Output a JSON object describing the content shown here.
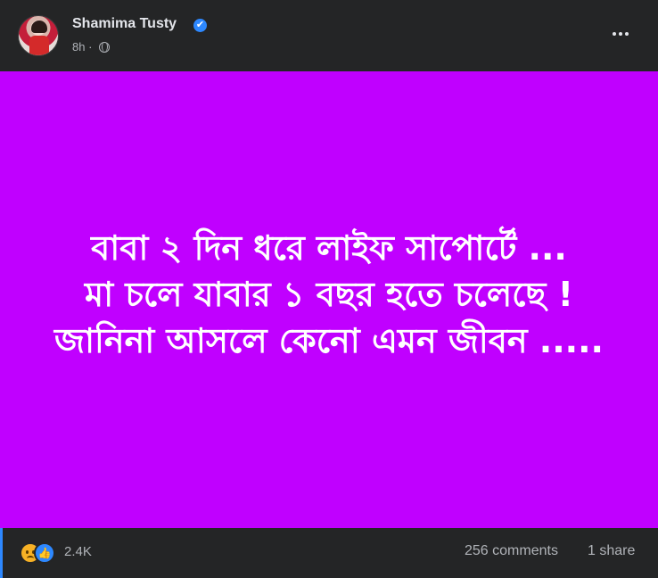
{
  "header": {
    "author_name": "Shamima Tusty",
    "verified_mark": "✔",
    "timestamp": "8h ·",
    "privacy_icon": "globe-icon",
    "more_icon": "more-options-icon"
  },
  "post": {
    "background_color": "#c000ff",
    "lines": [
      "বাবা ২ দিন ধরে লাইফ সাপোর্টে ...",
      "মা চলে যাবার ১ বছর হতে চলেছে !",
      "জানিনা আসলে কেনো এমন জীবন ....."
    ]
  },
  "footer": {
    "reaction_icons": [
      "sad-icon",
      "like-icon"
    ],
    "like_glyph": "👍",
    "reaction_count": "2.4K",
    "comments": "256 comments",
    "shares": "1 share"
  },
  "colors": {
    "background": "#242526",
    "text_primary": "#e4e6eb",
    "text_secondary": "#b0b3b8",
    "accent": "#2d88ff"
  }
}
